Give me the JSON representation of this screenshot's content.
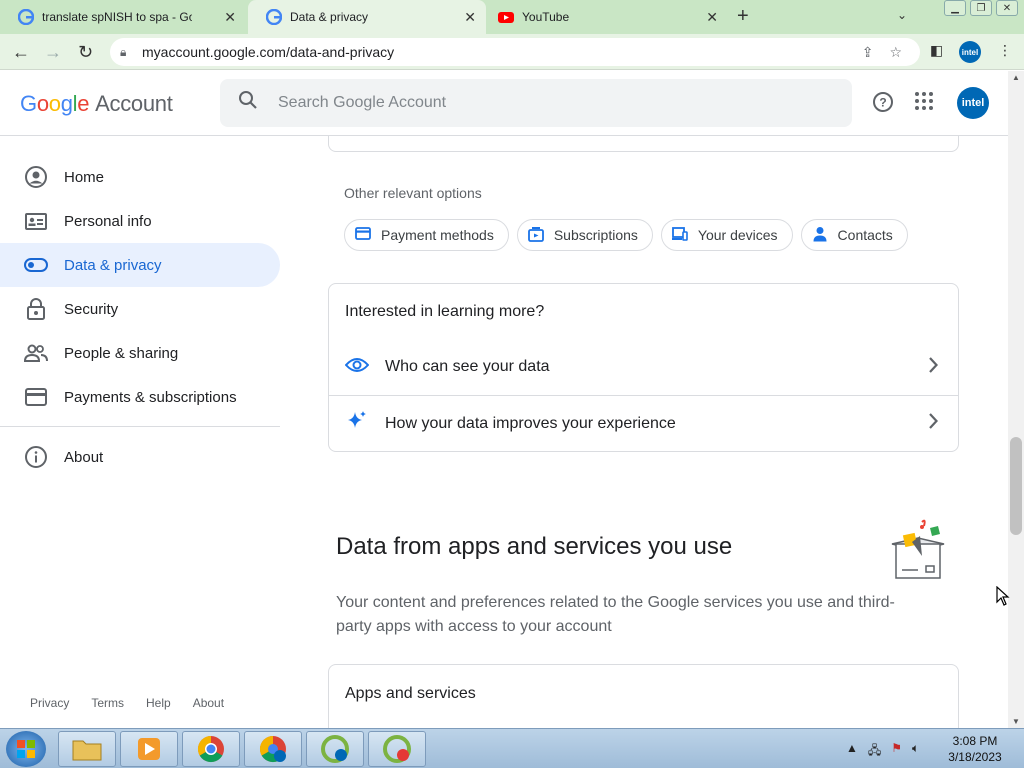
{
  "browser": {
    "tabs": [
      {
        "title": "translate spNISH to spa - Google",
        "active": false
      },
      {
        "title": "Data & privacy",
        "active": true
      },
      {
        "title": "YouTube",
        "active": false
      }
    ],
    "url": "myaccount.google.com/data-and-privacy",
    "profile_label": "intel"
  },
  "header": {
    "logo_google": "Google",
    "logo_account": "Account",
    "search_placeholder": "Search Google Account",
    "avatar_label": "intel"
  },
  "sidebar": {
    "items": [
      {
        "label": "Home",
        "icon": "person-circle-icon"
      },
      {
        "label": "Personal info",
        "icon": "id-card-icon"
      },
      {
        "label": "Data & privacy",
        "icon": "toggle-icon",
        "active": true
      },
      {
        "label": "Security",
        "icon": "lock-icon"
      },
      {
        "label": "People & sharing",
        "icon": "people-icon"
      },
      {
        "label": "Payments & subscriptions",
        "icon": "credit-card-icon"
      },
      {
        "label": "About",
        "icon": "info-icon"
      }
    ],
    "footer": [
      "Privacy",
      "Terms",
      "Help",
      "About"
    ]
  },
  "main": {
    "other_options_label": "Other relevant options",
    "chips": [
      {
        "label": "Payment methods",
        "icon": "credit-card-icon"
      },
      {
        "label": "Subscriptions",
        "icon": "subscriptions-icon"
      },
      {
        "label": "Your devices",
        "icon": "devices-icon"
      },
      {
        "label": "Contacts",
        "icon": "contact-icon"
      }
    ],
    "learn_card": {
      "title": "Interested in learning more?",
      "rows": [
        {
          "label": "Who can see your data",
          "icon": "eye-icon"
        },
        {
          "label": "How your data improves your experience",
          "icon": "sparkle-icon"
        }
      ]
    },
    "apps_section": {
      "title": "Data from apps and services you use",
      "description": "Your content and preferences related to the Google services you use and third-party apps with access to your account",
      "card_title": "Apps and services"
    }
  },
  "taskbar": {
    "time": "3:08 PM",
    "date": "3/18/2023"
  },
  "colors": {
    "accent": "#1a73e8",
    "active_nav_bg": "#e8f0fe",
    "tab_strip": "#c9e6c5"
  }
}
